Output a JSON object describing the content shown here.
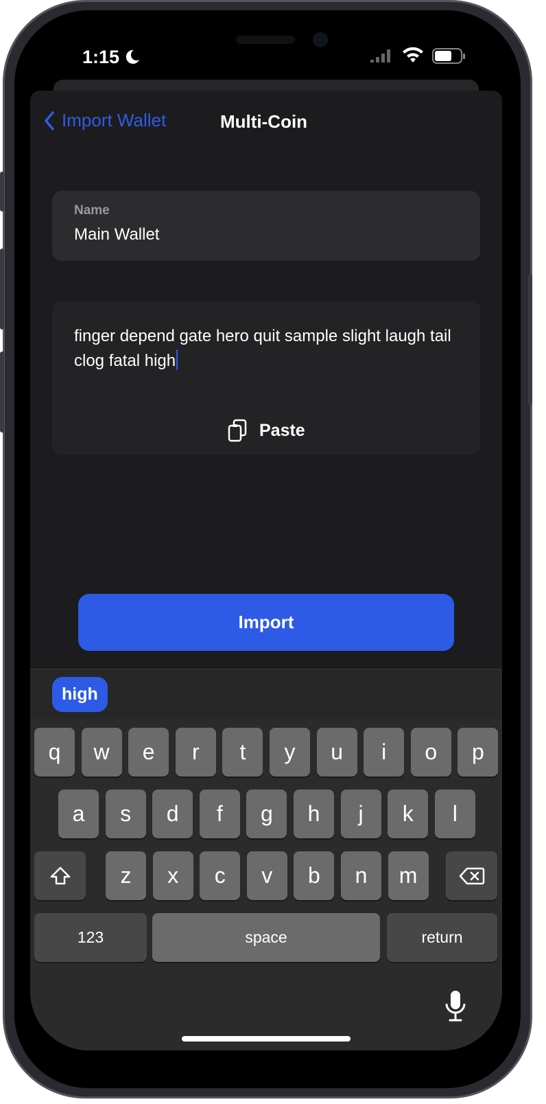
{
  "status_bar": {
    "time": "1:15",
    "icons": [
      "moon-icon",
      "cellular-signal-icon",
      "wifi-icon",
      "battery-icon"
    ]
  },
  "nav": {
    "back_label": "Import Wallet",
    "title": "Multi-Coin"
  },
  "name_field": {
    "label": "Name",
    "value": "Main Wallet"
  },
  "phrase_field": {
    "value": "finger depend gate hero quit sample slight laugh tail clog fatal high",
    "paste_label": "Paste"
  },
  "import_button": {
    "label": "Import"
  },
  "keyboard": {
    "suggestion": "high",
    "rows": [
      [
        "q",
        "w",
        "e",
        "r",
        "t",
        "y",
        "u",
        "i",
        "o",
        "p"
      ],
      [
        "a",
        "s",
        "d",
        "f",
        "g",
        "h",
        "j",
        "k",
        "l"
      ],
      [
        "z",
        "x",
        "c",
        "v",
        "b",
        "n",
        "m"
      ]
    ],
    "numbers_label": "123",
    "space_label": "space",
    "return_label": "return"
  },
  "colors": {
    "accent": "#2d5be6",
    "sheet": "#1c1c1e",
    "key": "#6b6b6b"
  }
}
